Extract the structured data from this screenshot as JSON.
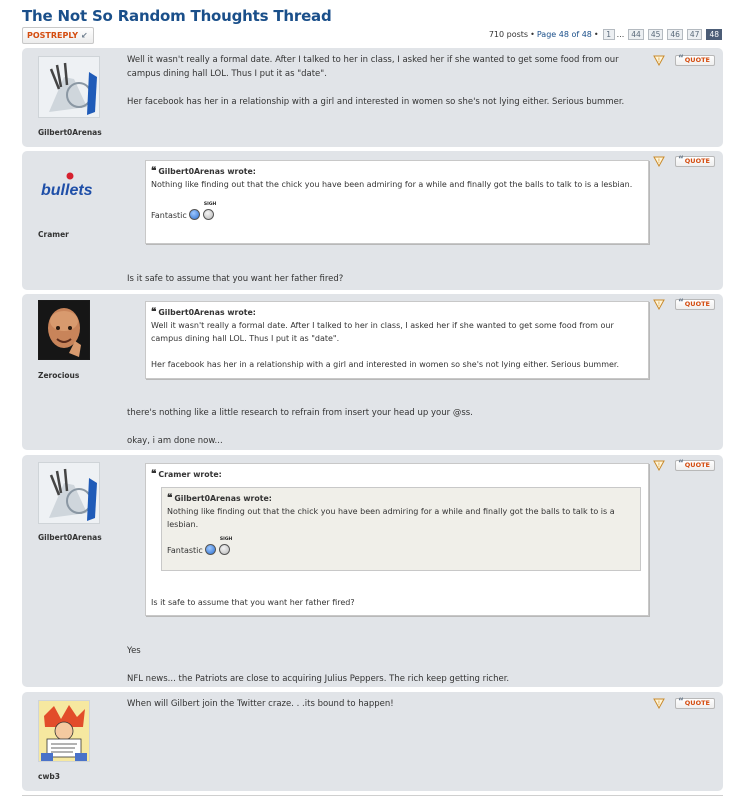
{
  "thread": {
    "title": "The Not So Random Thoughts Thread",
    "postreply_label": "POSTREPLY",
    "posts_count": "710 posts",
    "page_label": "Page 48 of 48",
    "pages": [
      "1",
      "...",
      "44",
      "45",
      "46",
      "47",
      "48"
    ],
    "active_page": "48"
  },
  "common": {
    "quote_label": "QUOTE",
    "quote_mark": "“",
    "sigh_label": "SIGH"
  },
  "posts": [
    {
      "author": "Gilbert0Arenas",
      "body": [
        "Well it wasn't really a formal date. After I talked to her in class, I asked her if she wanted to get some food from our campus dining hall LOL. Thus I put it as \"date\".",
        "Her facebook has her in a relationship with a girl and interested in women so she's not lying either. Serious bummer."
      ]
    },
    {
      "author": "Cramer",
      "avatar_text": "bullets",
      "quote": {
        "cite": "Gilbert0Arenas wrote:",
        "text": "Nothing like finding out that the chick you have been admiring for a while and finally got the balls to talk to is a lesbian.",
        "fantastic": "Fantastic"
      },
      "body": [
        "Is it safe to assume that you want her father fired?"
      ]
    },
    {
      "author": "Zerocious",
      "quote": {
        "cite": "Gilbert0Arenas wrote:",
        "text1": "Well it wasn't really a formal date. After I talked to her in class, I asked her if she wanted to get some food from our campus dining hall LOL. Thus I put it as \"date\".",
        "text2": "Her facebook has her in a relationship with a girl and interested in women so she's not lying either. Serious bummer."
      },
      "body": [
        "there's nothing like a little research to refrain from insert your head up your @ss.",
        "okay, i am done now..."
      ]
    },
    {
      "author": "Gilbert0Arenas",
      "quote": {
        "cite": "Cramer wrote:",
        "inner_cite": "Gilbert0Arenas wrote:",
        "inner_text": "Nothing like finding out that the chick you have been admiring for a while and finally got the balls to talk to is a lesbian.",
        "fantastic": "Fantastic",
        "text": "Is it safe to assume that you want her father fired?"
      },
      "body": [
        "Yes",
        "NFL news... the Patriots are close to acquiring Julius Peppers. The rich keep getting richer."
      ]
    },
    {
      "author": "cwb3",
      "body": [
        "When will Gilbert join the Twitter craze. . .its bound to happen!"
      ]
    }
  ]
}
